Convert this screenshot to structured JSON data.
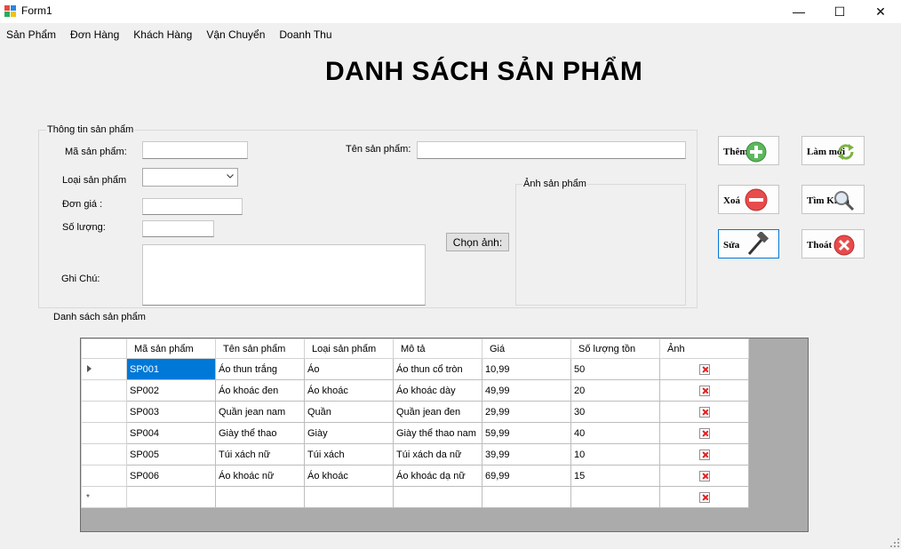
{
  "window": {
    "title": "Form1",
    "minimize": "—",
    "maximize": "☐",
    "close": "✕"
  },
  "menu": [
    "Sản Phẩm",
    "Đơn Hàng",
    "Khách Hàng",
    "Vận Chuyển",
    "Doanh Thu"
  ],
  "page_title": "DANH SÁCH SẢN PHẨM",
  "product_info": {
    "legend": "Thông tin sản phẩm",
    "ma_label": "Mã sản phẩm:",
    "ma_value": "",
    "loai_label": "Loại sản phẩm",
    "loai_value": "",
    "gia_label": "Đơn giá :",
    "gia_value": "",
    "soluong_label": "Số lượng:",
    "soluong_value": "",
    "ghichu_label": "Ghi Chú:",
    "ghichu_value": "",
    "ten_label": "Tên sản phẩm:",
    "ten_value": "",
    "choose_image": "Chọn ảnh:",
    "image_legend": "Ảnh sản phẩm"
  },
  "actions": {
    "them": "Thêm",
    "xoa": "Xoá",
    "sua": "Sửa",
    "lammoi": "Làm mới",
    "timkiem": "Tìm Kiếm",
    "thoat": "Thoát"
  },
  "list_label": "Danh sách sản phẩm",
  "grid": {
    "columns": [
      "Mã sản phẩm",
      "Tên sản phẩm",
      "Loại sản phẩm",
      "Mô tả",
      "Giá",
      "Số lượng tồn",
      "Ảnh"
    ],
    "rows": [
      [
        "SP001",
        "Áo thun trắng",
        "Áo",
        "Áo thun cổ tròn",
        "10,99",
        "50"
      ],
      [
        "SP002",
        "Áo khoác đen",
        "Áo khoác",
        "Áo khoác dày",
        "49,99",
        "20"
      ],
      [
        "SP003",
        "Quần jean nam",
        "Quần",
        "Quần jean đen",
        "29,99",
        "30"
      ],
      [
        "SP004",
        "Giày thể thao",
        "Giày",
        "Giày thể thao nam",
        "59,99",
        "40"
      ],
      [
        "SP005",
        "Túi xách nữ",
        "Túi xách",
        "Túi xách da nữ",
        "39,99",
        "10"
      ],
      [
        "SP006",
        "Áo khoác nữ",
        "Áo khoác",
        "Áo khoác dạ nữ",
        "69,99",
        "15"
      ]
    ],
    "new_row_marker": "*"
  },
  "colors": {
    "selection": "#0078d7",
    "focus_border": "#0078d7"
  }
}
